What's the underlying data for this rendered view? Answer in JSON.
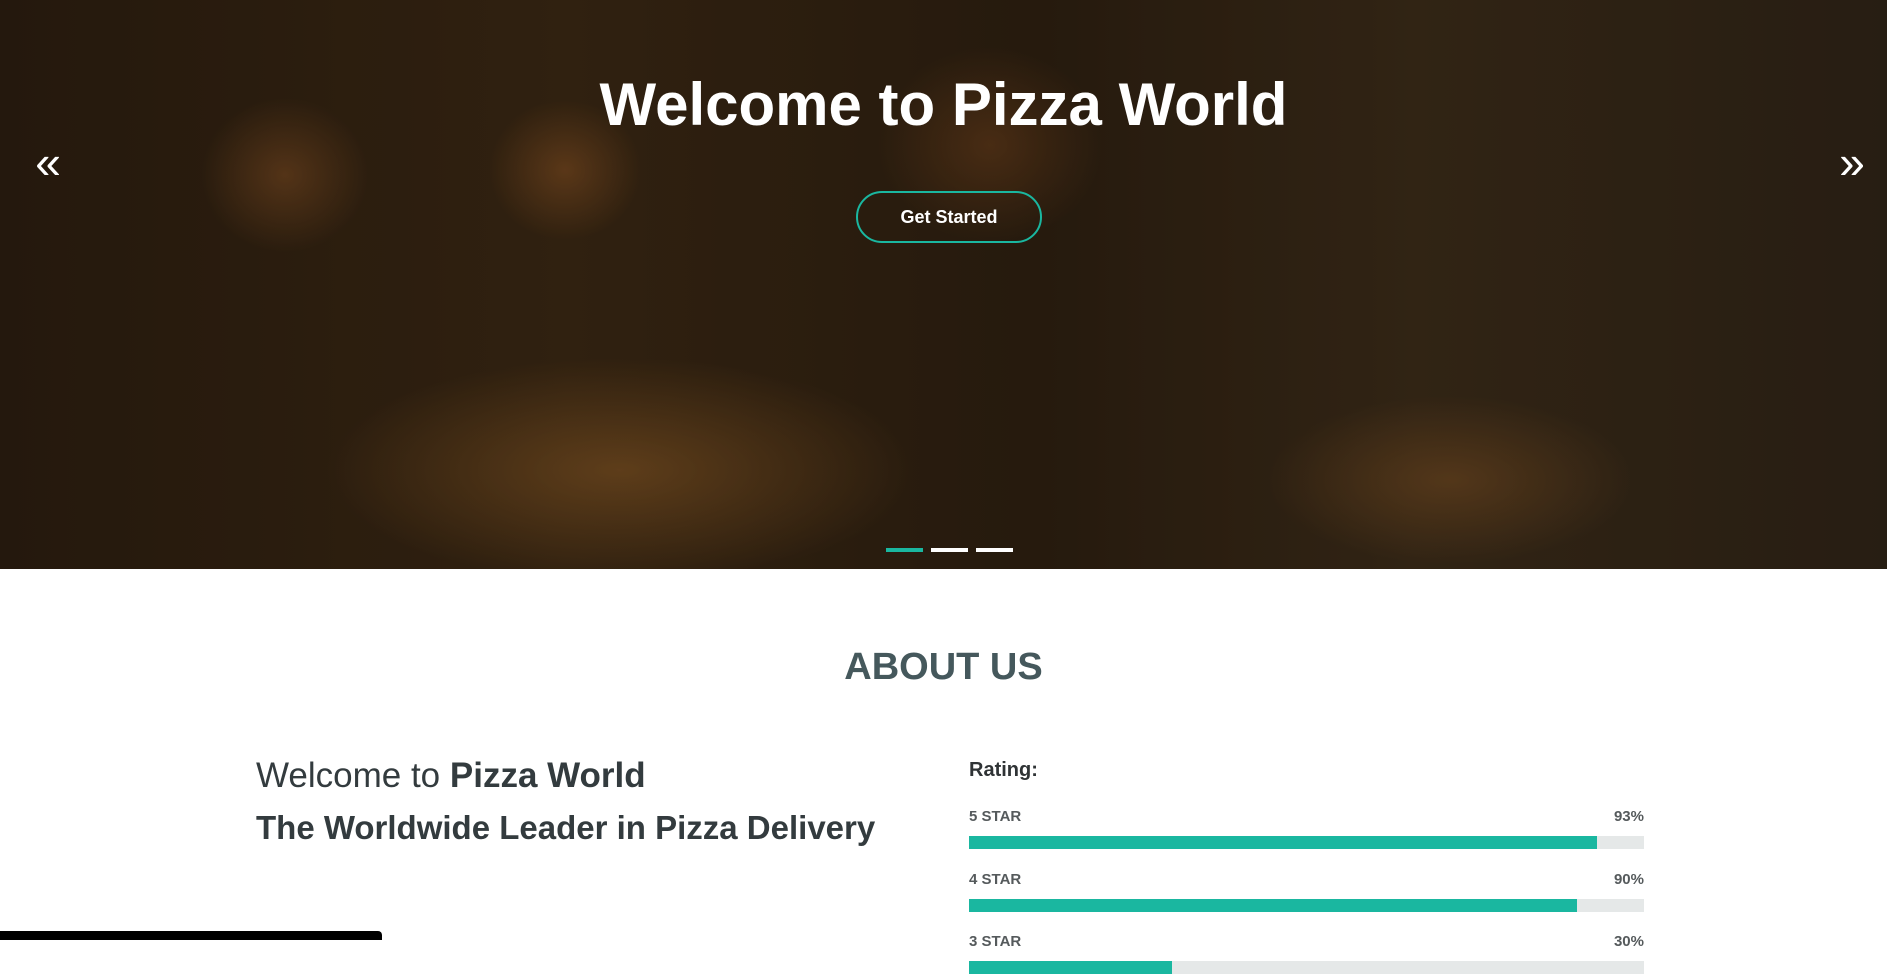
{
  "hero": {
    "title": "Welcome to Pizza World",
    "cta_label": "Get Started",
    "prev_icon": "«",
    "next_icon": "»",
    "slides_total": 3,
    "active_slide": 1
  },
  "about": {
    "heading": "ABOUT US",
    "welcome_prefix": "Welcome to ",
    "welcome_brand": "Pizza World",
    "tagline": "The Worldwide Leader in Pizza Delivery"
  },
  "rating": {
    "title": "Rating:",
    "items": [
      {
        "label": "5 STAR",
        "value_text": "93%",
        "percent": 93
      },
      {
        "label": "4 STAR",
        "value_text": "90%",
        "percent": 90
      },
      {
        "label": "3 STAR",
        "value_text": "30%",
        "percent": 30
      }
    ]
  },
  "colors": {
    "accent": "#1ab7a0",
    "track": "#e5e8e8",
    "heading": "#45585c"
  }
}
